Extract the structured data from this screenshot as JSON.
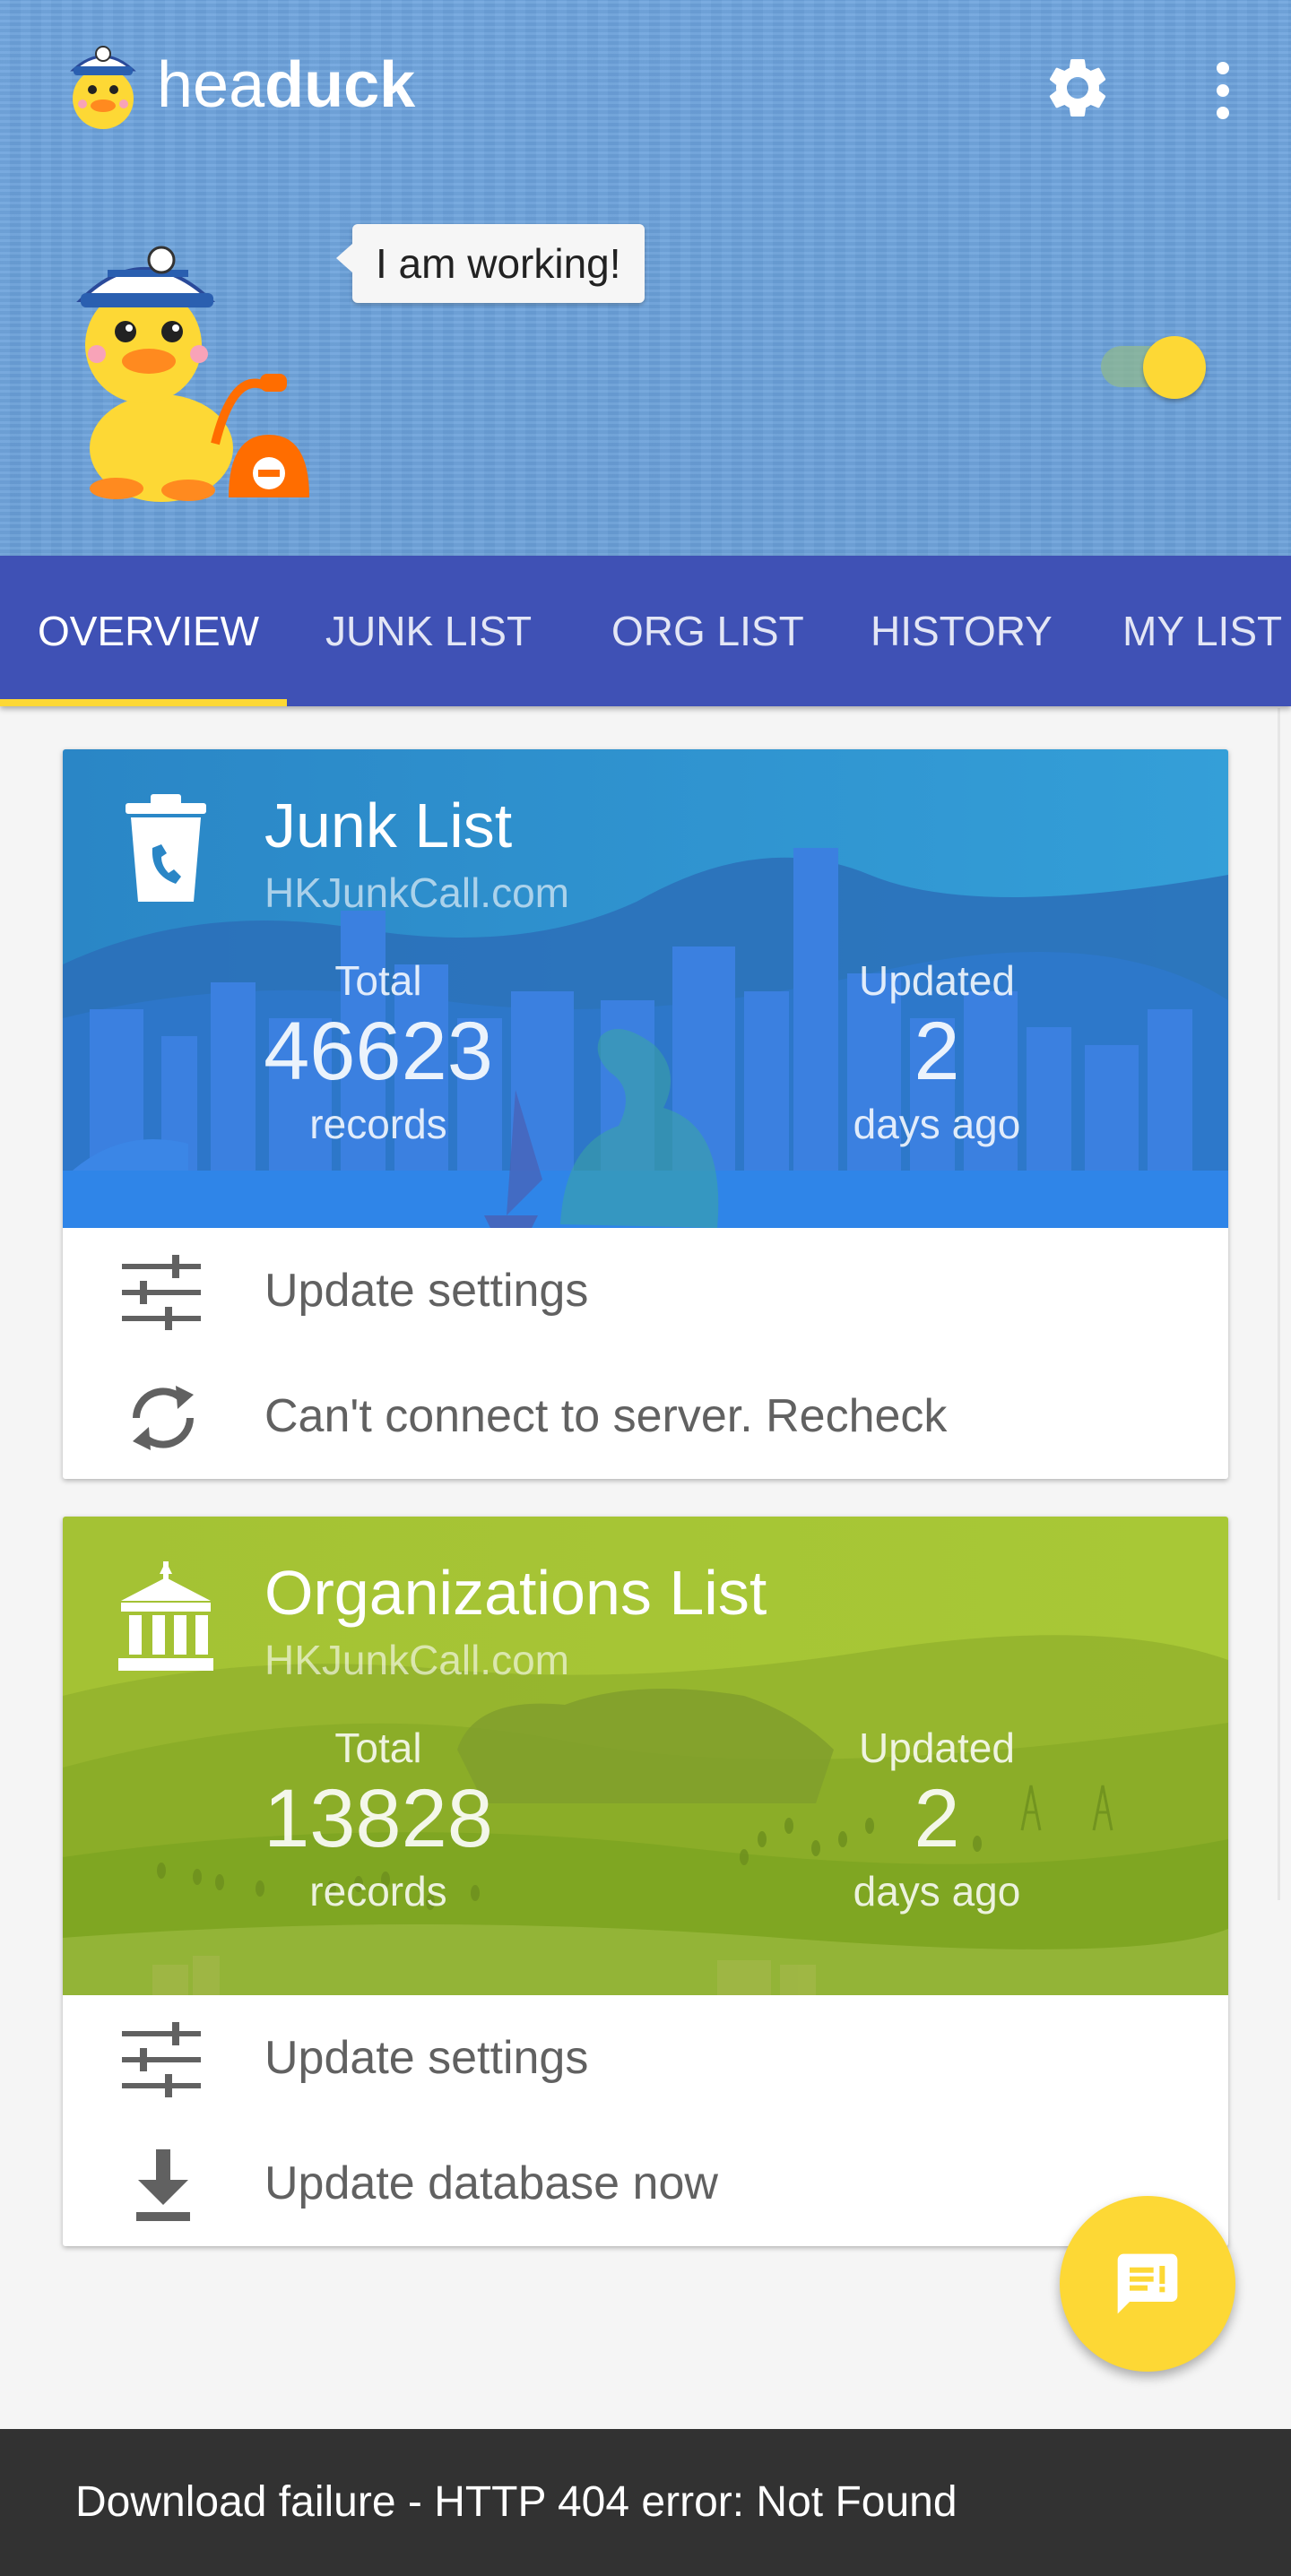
{
  "app": {
    "title_light": "hea",
    "title_bold": "duck",
    "speech_bubble": "I am working!",
    "toggle_on": true,
    "accent_color": "#fdd835",
    "primary_color": "#3f51b5"
  },
  "tabs": [
    {
      "label": "OVERVIEW",
      "active": true
    },
    {
      "label": "JUNK LIST",
      "active": false
    },
    {
      "label": "ORG LIST",
      "active": false
    },
    {
      "label": "HISTORY",
      "active": false
    },
    {
      "label": "MY LIST",
      "active": false
    }
  ],
  "junk_card": {
    "title": "Junk List",
    "source": "HKJunkCall.com",
    "total_label": "Total",
    "total_value": "46623",
    "total_unit": "records",
    "updated_label": "Updated",
    "updated_value": "2",
    "updated_unit": "days ago",
    "actions": [
      {
        "icon": "tune-icon",
        "label": "Update settings"
      },
      {
        "icon": "sync-icon",
        "label": "Can't connect to server. Recheck"
      }
    ]
  },
  "org_card": {
    "title": "Organizations List",
    "source": "HKJunkCall.com",
    "total_label": "Total",
    "total_value": "13828",
    "total_unit": "records",
    "updated_label": "Updated",
    "updated_value": "2",
    "updated_unit": "days ago",
    "actions": [
      {
        "icon": "tune-icon",
        "label": "Update settings"
      },
      {
        "icon": "download-icon",
        "label": "Update database now"
      }
    ]
  },
  "snackbar": {
    "message": "Download failure - HTTP 404 error: Not Found"
  },
  "icons": {
    "settings": "gear-icon",
    "menu": "more-vert-icon",
    "fab": "feedback-icon",
    "junk_card": "trash-phone-icon",
    "org_card": "bank-icon"
  }
}
